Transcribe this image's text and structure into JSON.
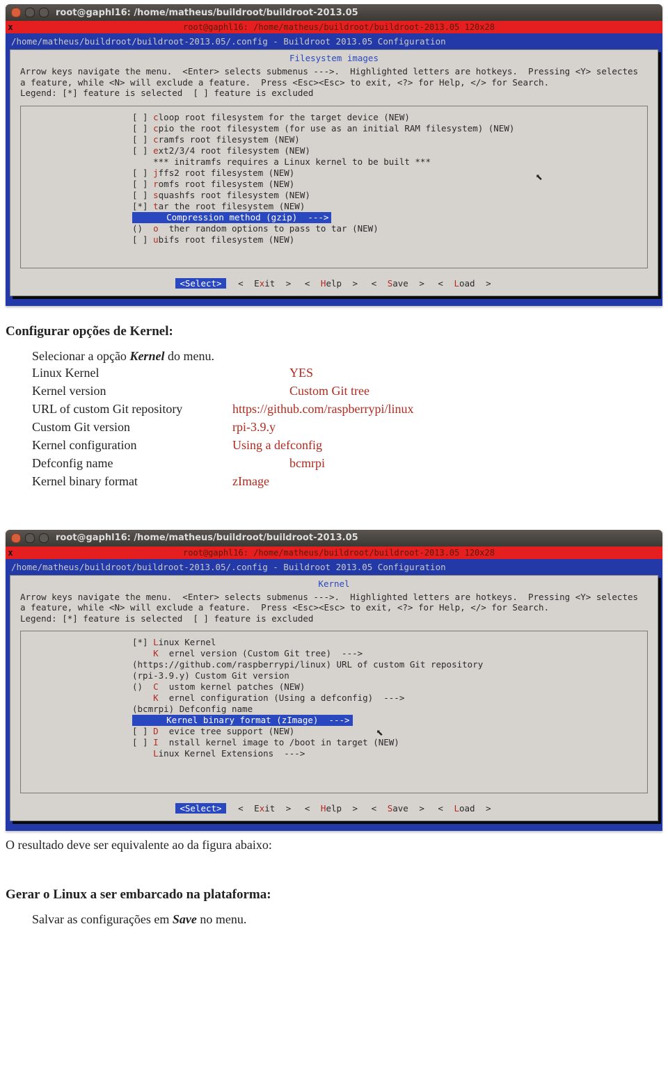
{
  "window": {
    "title": "root@gaphl16: /home/matheus/buildroot/buildroot-2013.05",
    "red_strip": "root@gaphl16: /home/matheus/buildroot/buildroot-2013.05 120x28",
    "config_path": "/home/matheus/buildroot/buildroot-2013.05/.config - Buildroot 2013.05 Configuration",
    "help": "Arrow keys navigate the menu.  <Enter> selects submenus --->.  Highlighted letters are hotkeys.  Pressing <Y> selectes a feature, while <N> will exclude a feature.  Press <Esc><Esc> to exit, <?> for Help, </> for Search.\nLegend: [*] feature is selected  [ ] feature is excluded"
  },
  "term1": {
    "panel_title": "Filesystem images",
    "items": [
      {
        "mark": "[ ]",
        "hot": "c",
        "text": "loop root filesystem for the target device (NEW)"
      },
      {
        "mark": "[ ]",
        "hot": "c",
        "text": "pio the root filesystem (for use as an initial RAM filesystem) (NEW)"
      },
      {
        "mark": "[ ]",
        "hot": "c",
        "text": "ramfs root filesystem (NEW)"
      },
      {
        "mark": "[ ]",
        "hot": "e",
        "text": "xt2/3/4 root filesystem (NEW)"
      },
      {
        "mark": "   ",
        "hot": "",
        "text": "*** initramfs requires a Linux kernel to be built ***",
        "indent": true
      },
      {
        "mark": "[ ]",
        "hot": "j",
        "text": "ffs2 root filesystem (NEW)"
      },
      {
        "mark": "[ ]",
        "hot": "r",
        "text": "omfs root filesystem (NEW)"
      },
      {
        "mark": "[ ]",
        "hot": "s",
        "text": "quashfs root filesystem (NEW)"
      },
      {
        "mark": "[*]",
        "hot": "t",
        "text": "ar the root filesystem (NEW)"
      },
      {
        "mark": "hi",
        "hot": "",
        "text": "      Compression method (gzip)  --->"
      },
      {
        "mark": "() ",
        "hot": "o",
        "text": "  ther random options to pass to tar (NEW)"
      },
      {
        "mark": "[ ]",
        "hot": "u",
        "text": "bifs root filesystem (NEW)"
      }
    ]
  },
  "term2": {
    "panel_title": "Kernel",
    "items": [
      {
        "mark": "[*]",
        "hot": "L",
        "text": "inux Kernel"
      },
      {
        "mark": "   ",
        "hot": "K",
        "text": "  ernel version (Custom Git tree)  --->"
      },
      {
        "mark": "",
        "hot": "",
        "text": "(https://github.com/raspberrypi/linux) URL of custom Git repository",
        "raw": true
      },
      {
        "mark": "",
        "hot": "",
        "text": "(rpi-3.9.y) Custom Git version",
        "raw": true
      },
      {
        "mark": "() ",
        "hot": "C",
        "text": "  ustom kernel patches (NEW)"
      },
      {
        "mark": "   ",
        "hot": "K",
        "text": "  ernel configuration (Using a defconfig)  --->"
      },
      {
        "mark": "",
        "hot": "",
        "text": "(bcmrpi) Defconfig name",
        "raw": true
      },
      {
        "mark": "hi",
        "hot": "",
        "text": "      Kernel binary format (zImage)  --->"
      },
      {
        "mark": "[ ]",
        "hot": "D",
        "text": "  evice tree support (NEW)"
      },
      {
        "mark": "[ ]",
        "hot": "I",
        "text": "  nstall kernel image to /boot in target (NEW)"
      },
      {
        "mark": "   ",
        "hot": "L",
        "text": "inux Kernel Extensions  --->"
      }
    ]
  },
  "buttons": {
    "select": "<Select>",
    "exit": "< Exit >",
    "help": "< Help >",
    "save": "< Save >",
    "load": "< Load >"
  },
  "doc": {
    "h1": "Configurar opções de Kernel:",
    "line0a": "Selecionar a opção ",
    "line0b": "Kernel",
    "line0c": " do menu.",
    "cfg": [
      {
        "label": "Linux Kernel",
        "value": "YES",
        "lw": 370
      },
      {
        "label": "Kernel version",
        "value": "Custom Git tree",
        "lw": 370
      },
      {
        "label": "URL of custom Git repository",
        "value": "https://github.com/raspberrypi/linux",
        "lw": 288
      },
      {
        "label": "Custom Git version",
        "value": "rpi-3.9.y",
        "lw": 288
      },
      {
        "label": "Kernel configuration",
        "value": "Using a defconfig",
        "lw": 288
      },
      {
        "label": "Defconfig name",
        "value": "bcmrpi",
        "lw": 370
      },
      {
        "label": "Kernel binary format",
        "value": "zImage",
        "lw": 288
      }
    ],
    "result_line": "O resultado deve ser equivalente ao da figura abaixo:",
    "h2": "Gerar o Linux a ser embarcado na plataforma:",
    "save_a": "Salvar as configurações em ",
    "save_b": "Save",
    "save_c": " no menu."
  }
}
